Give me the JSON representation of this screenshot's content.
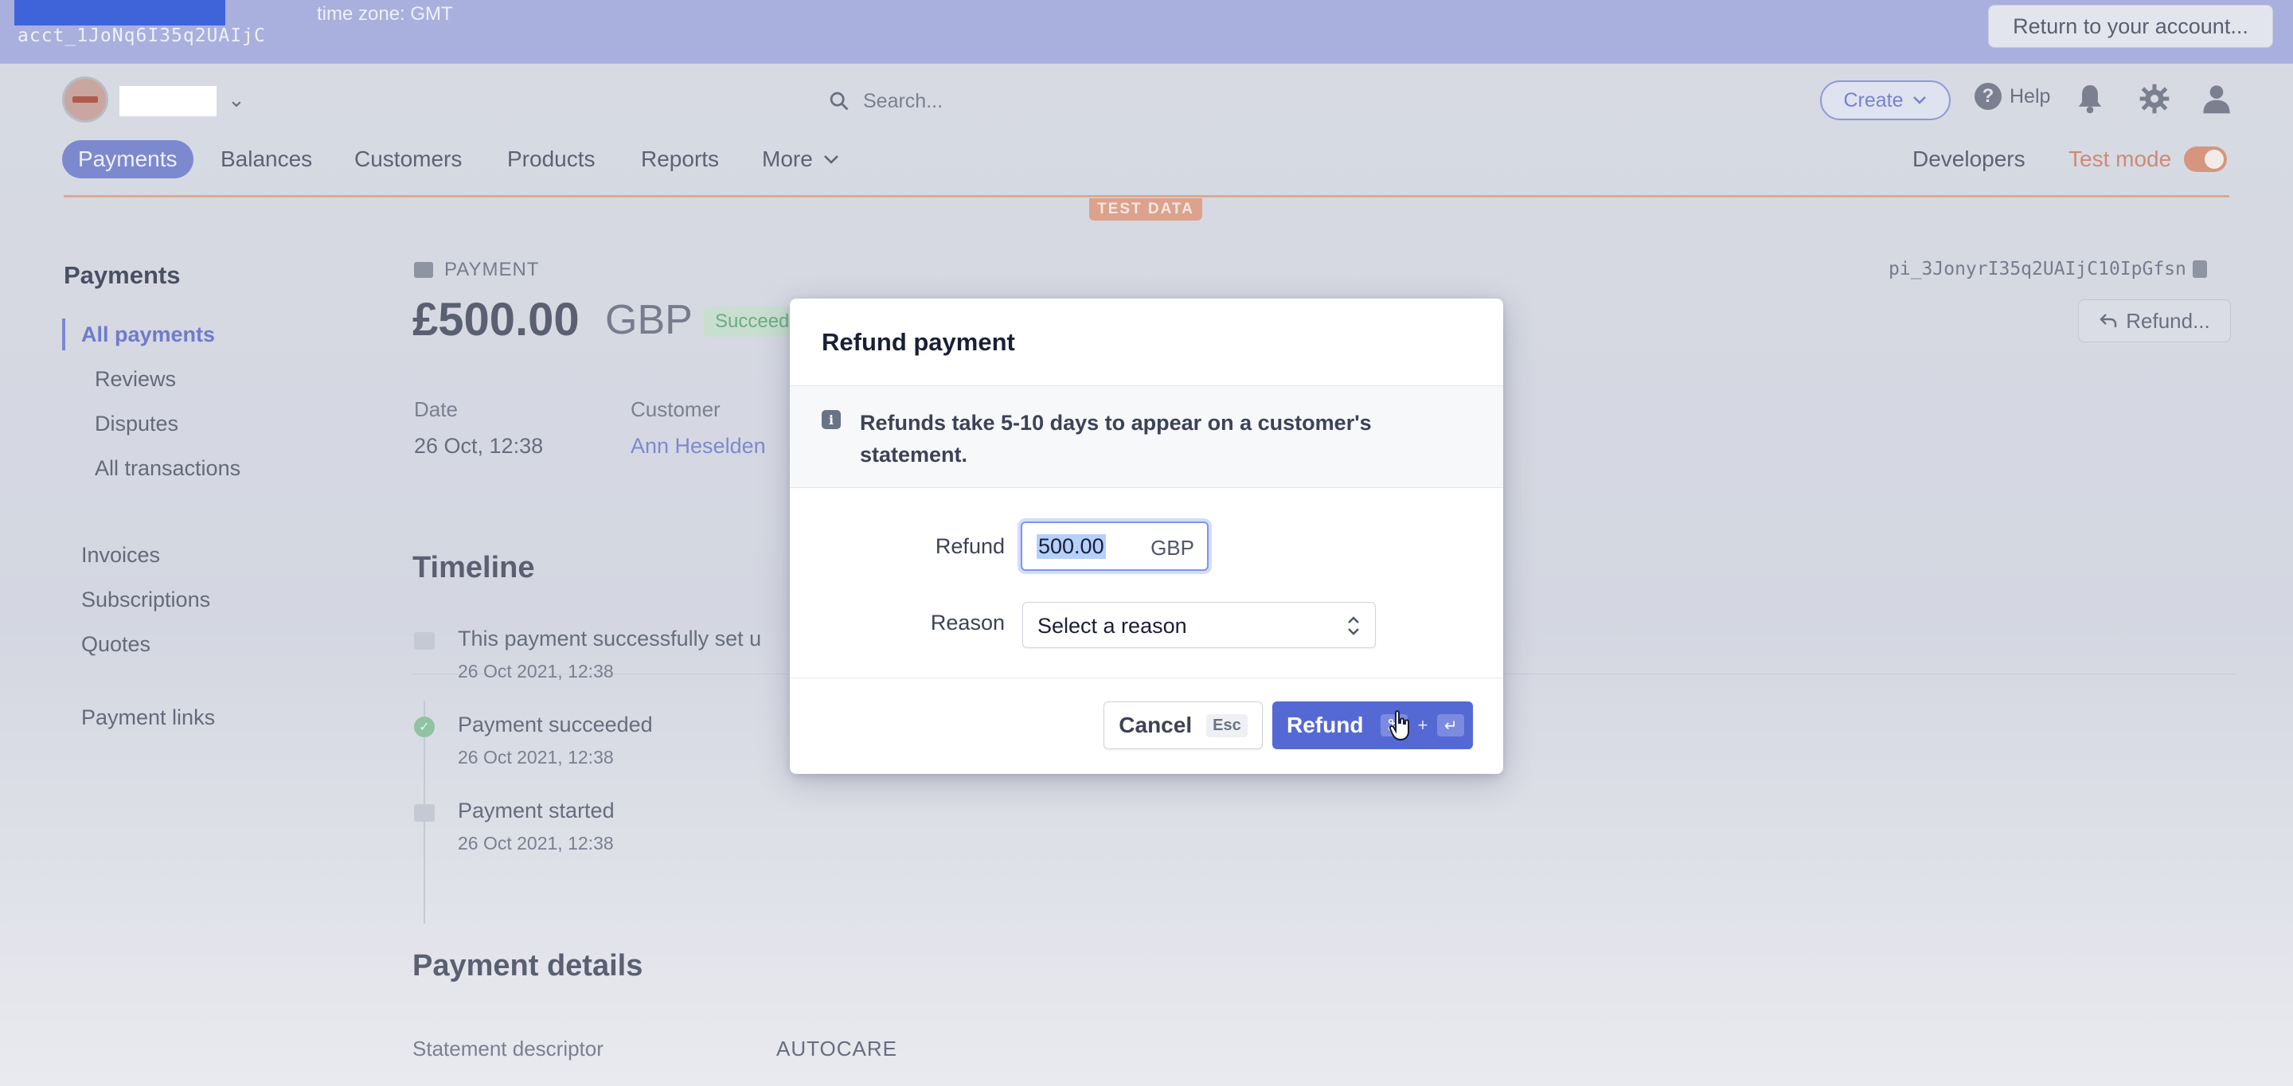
{
  "admin_bar": {
    "account_id": "acct_1JoNq6I35q2UAIjC",
    "timezone": "time zone: GMT",
    "return_label": "Return to your account..."
  },
  "header": {
    "search_placeholder": "Search...",
    "create_label": "Create",
    "help_label": "Help"
  },
  "nav": {
    "tabs": [
      "Payments",
      "Balances",
      "Customers",
      "Products",
      "Reports",
      "More"
    ],
    "developers": "Developers",
    "test_mode": "Test mode",
    "test_mode_on": true,
    "test_data_badge": "TEST DATA"
  },
  "sidebar": {
    "title": "Payments",
    "items": [
      "All payments",
      "Reviews",
      "Disputes",
      "All transactions",
      "Invoices",
      "Subscriptions",
      "Quotes",
      "Payment links"
    ]
  },
  "payment": {
    "label": "PAYMENT",
    "amount": "£500.00",
    "currency": "GBP",
    "status": "Succeed",
    "id": "pi_3JonyrI35q2UAIjC10IpGfsn",
    "refund_button": "Refund...",
    "date_label": "Date",
    "date_value": "26 Oct, 12:38",
    "customer_label": "Customer",
    "customer_value": "Ann Heselden"
  },
  "timeline": {
    "title": "Timeline",
    "events": [
      {
        "text": "This payment successfully set u",
        "date": "26 Oct 2021, 12:38"
      },
      {
        "text": "Payment succeeded",
        "date": "26 Oct 2021, 12:38"
      },
      {
        "text": "Payment started",
        "date": "26 Oct 2021, 12:38"
      }
    ]
  },
  "payment_details": {
    "title": "Payment details",
    "statement_descriptor_label": "Statement descriptor",
    "statement_descriptor_value": "AUTOCARE"
  },
  "modal": {
    "title": "Refund payment",
    "notice": "Refunds take 5-10 days to appear on a customer's statement.",
    "refund_label": "Refund",
    "refund_amount": "500.00",
    "refund_currency": "GBP",
    "reason_label": "Reason",
    "reason_value": "Select a reason",
    "cancel_label": "Cancel",
    "cancel_shortcut": "Esc",
    "submit_label": "Refund",
    "submit_key_1": "⌘",
    "submit_key_plus": "+",
    "submit_key_2": "↵"
  },
  "colors": {
    "accent": "#5469d4",
    "test_mode": "#d6957f",
    "success": "#8fc3a3"
  }
}
